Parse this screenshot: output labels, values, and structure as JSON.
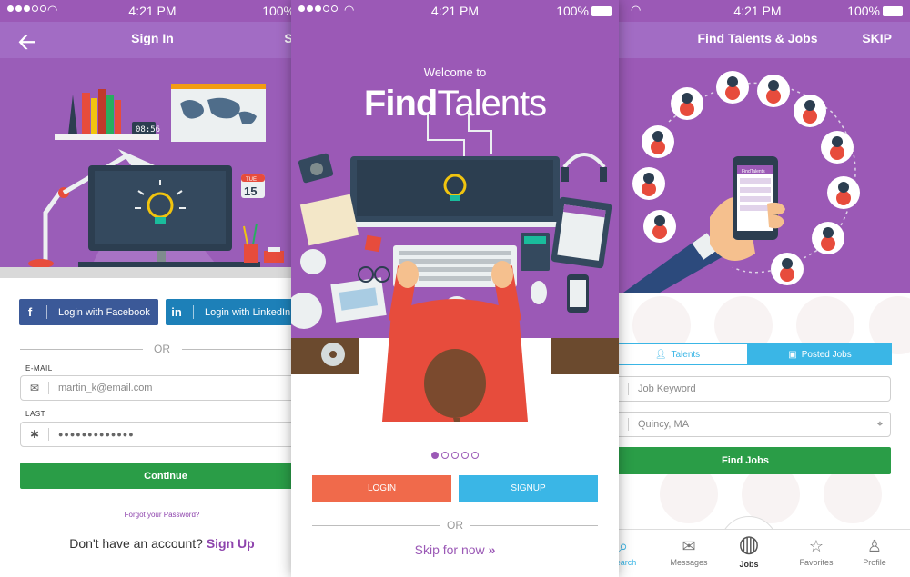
{
  "status": {
    "time": "4:21 PM",
    "battery": "100%"
  },
  "signin": {
    "nav_title": "Sign In",
    "nav_right": "SKIP",
    "facebook_label": "Login with Facebook",
    "linkedin_label": "Login with LinkedIn",
    "or_text": "OR",
    "email_label": "E-MAIL",
    "email_value": "martin_k@email.com",
    "last_label": "LAST",
    "password_value": "●●●●●●●●●●●●●",
    "continue_label": "Continue",
    "forgot_label": "Forgot your Password?",
    "no_account_text": "Don't have an account?",
    "signup_link": "Sign Up",
    "calendar_day": "15",
    "calendar_month": "TUE"
  },
  "welcome": {
    "welcome_text": "Welcome to",
    "logo_bold": "Find",
    "logo_light": "Talents",
    "login_label": "LOGIN",
    "signup_label": "SIGNUP",
    "or_text": "OR",
    "skip_label": "Skip for now",
    "pages_total": 5,
    "page_current": 1
  },
  "find": {
    "nav_title": "Find Talents & Jobs",
    "nav_right": "SKIP",
    "segment_talents": "Talents",
    "segment_posted": "Posted Jobs",
    "keyword_placeholder": "Job Keyword",
    "location_value": "Quincy, MA",
    "find_button": "Find Jobs",
    "tabs": [
      {
        "label": "Search",
        "icon": "search-icon"
      },
      {
        "label": "Messages",
        "icon": "envelope-icon"
      },
      {
        "label": "Jobs",
        "icon": "globe-icon"
      },
      {
        "label": "Favorites",
        "icon": "star-icon"
      },
      {
        "label": "Profile",
        "icon": "user-icon"
      }
    ],
    "phone_label": "FindTalents"
  },
  "colors": {
    "purple": "#9b59b6",
    "green": "#2a9d47",
    "facebook": "#3b5998",
    "linkedin": "#1d80b8",
    "login_red": "#f06a4b",
    "signup_blue": "#3ab6e6"
  }
}
